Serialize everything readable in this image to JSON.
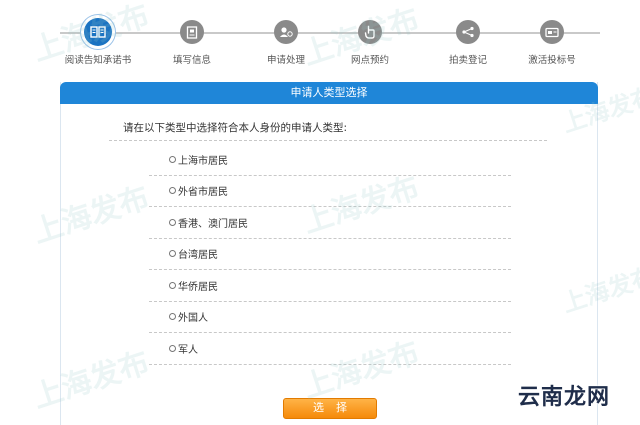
{
  "steps": [
    {
      "label": "阅读告知承诺书",
      "icon": "book-icon",
      "active": true
    },
    {
      "label": "填写信息",
      "icon": "form-icon",
      "active": false
    },
    {
      "label": "申请处理",
      "icon": "user-process-icon",
      "active": false
    },
    {
      "label": "网点预约",
      "icon": "hand-pointer-icon",
      "active": false
    },
    {
      "label": "拍卖登记",
      "icon": "network-icon",
      "active": false
    },
    {
      "label": "激活投标号",
      "icon": "card-icon",
      "active": false
    }
  ],
  "panel": {
    "title": "申请人类型选择",
    "prompt": "请在以下类型中选择符合本人身份的申请人类型:",
    "options": [
      "上海市居民",
      "外省市居民",
      "香港、澳门居民",
      "台湾居民",
      "华侨居民",
      "外国人",
      "军人"
    ],
    "select_label": "选择"
  },
  "watermarks": {
    "text": "上海发布",
    "corner": "云南龙网"
  },
  "colors": {
    "accent": "#1f86d8",
    "active_step": "#1b73c2",
    "inactive_step": "#8a8a8a",
    "button": "#f58a0a"
  }
}
